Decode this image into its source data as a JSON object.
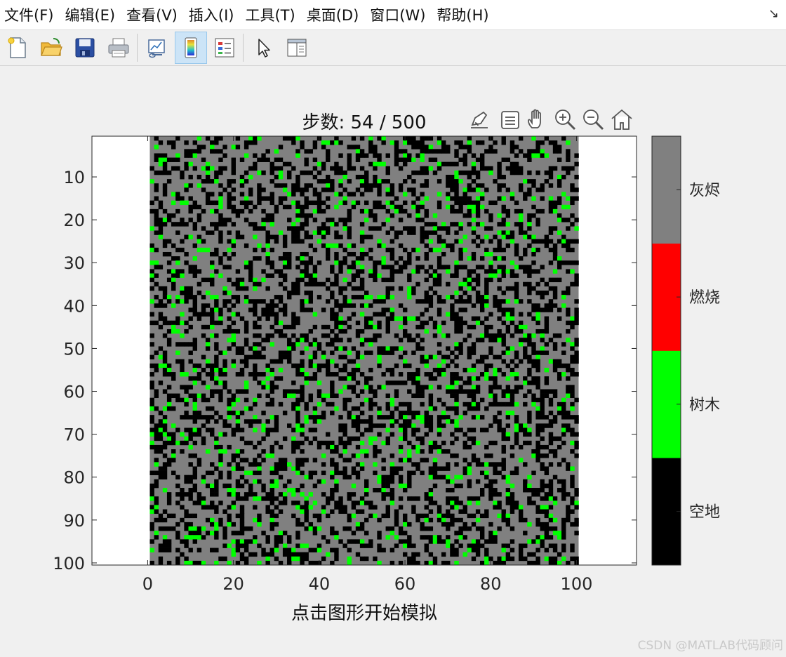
{
  "menu": {
    "items": [
      "文件(F)",
      "编辑(E)",
      "查看(V)",
      "插入(I)",
      "工具(T)",
      "桌面(D)",
      "窗口(W)",
      "帮助(H)"
    ],
    "pin_glyph": "↘"
  },
  "toolbar": {
    "buttons": [
      {
        "icon": "new-figure-icon"
      },
      {
        "icon": "open-file-icon"
      },
      {
        "icon": "save-icon"
      },
      {
        "icon": "print-icon"
      },
      {
        "icon": "link-plot-icon"
      },
      {
        "icon": "colorbar-icon",
        "active": true
      },
      {
        "icon": "legend-icon"
      },
      {
        "icon": "pointer-icon"
      },
      {
        "icon": "property-editor-icon"
      }
    ]
  },
  "axes_toolbar": {
    "icons": [
      "brush-icon",
      "data-tips-icon",
      "pan-icon",
      "zoom-in-icon",
      "zoom-out-icon",
      "home-icon"
    ]
  },
  "figure": {
    "title": "步数: 54 / 500",
    "xlabel": "点击图形开始模拟",
    "watermark": "CSDN @MATLAB代码顾问"
  },
  "chart_data": {
    "type": "heatmap",
    "title": "步数: 54 / 500",
    "xlabel": "点击图形开始模拟",
    "ylabel": "",
    "grid_size": [
      100,
      100
    ],
    "x_ticks": [
      0,
      20,
      40,
      60,
      80,
      100
    ],
    "y_ticks": [
      10,
      20,
      30,
      40,
      50,
      60,
      70,
      80,
      90,
      100
    ],
    "xlim": [
      -13,
      114
    ],
    "ylim": [
      0.5,
      100.5
    ],
    "y_direction": "reverse",
    "grid": false,
    "colormap": [
      "#000000",
      "#00ff00",
      "#ff0000",
      "#808080"
    ],
    "colorbar": {
      "labels": [
        "空地",
        "树木",
        "燃烧",
        "灰烬"
      ],
      "placement": "right"
    },
    "approx_state_fraction": {
      "空地": 0.33,
      "树木": 0.07,
      "燃烧": 0.0,
      "灰烬": 0.6
    }
  }
}
